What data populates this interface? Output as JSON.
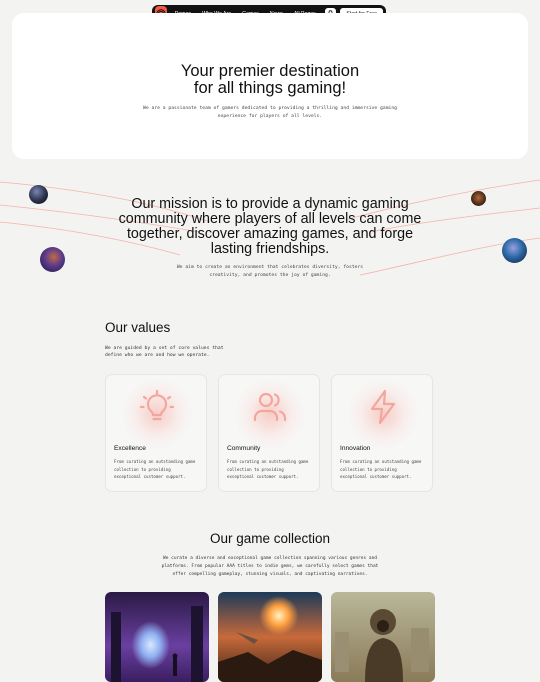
{
  "nav": {
    "items": [
      "Demos",
      "Who We Are",
      "Games",
      "News",
      "All Pages"
    ],
    "cta_label": "Start for Free",
    "logo_icon": "target-logo-icon",
    "lock_icon": "lock-icon"
  },
  "hero": {
    "title_line1": "Your premier destination",
    "title_line2": "for all things gaming!",
    "subtitle_line1": "We are a passionate team of gamers dedicated to providing a thrilling and immersive gaming",
    "subtitle_line2": "experience for players of all levels."
  },
  "mission": {
    "title_lines": [
      "Our mission is to provide a dynamic gaming",
      "community where players of all levels can come",
      "together, discover amazing games, and forge",
      "lasting friendships."
    ],
    "subtitle_lines": [
      "We aim to create an environment that celebrates diversity, fosters",
      "creativity, and promotes the joy of gaming."
    ]
  },
  "values": {
    "title": "Our values",
    "subtitle_lines": [
      "We are guided by a set of core values that",
      "define who we are and how we operate."
    ],
    "cards": [
      {
        "title": "Excellence",
        "icon": "lightbulb-icon",
        "text_lines": [
          "From curating an outstanding game",
          "collection to providing",
          "exceptional customer support."
        ]
      },
      {
        "title": "Community",
        "icon": "users-icon",
        "text_lines": [
          "From curating an outstanding game",
          "collection to providing",
          "exceptional customer support."
        ]
      },
      {
        "title": "Innovation",
        "icon": "lightning-icon",
        "text_lines": [
          "From curating an outstanding game",
          "collection to providing",
          "exceptional customer support."
        ]
      }
    ]
  },
  "collection": {
    "title": "Our game collection",
    "subtitle_lines": [
      "We curate a diverse and exceptional game collection spanning various genres and",
      "platforms. From popular AAA titles to indie gems, we carefully select games that",
      "offer compelling gameplay, stunning visuals, and captivating narratives."
    ]
  },
  "colors": {
    "accent": "#f15a46",
    "nav_bg": "#111111",
    "page_bg": "#f3f3f2"
  }
}
